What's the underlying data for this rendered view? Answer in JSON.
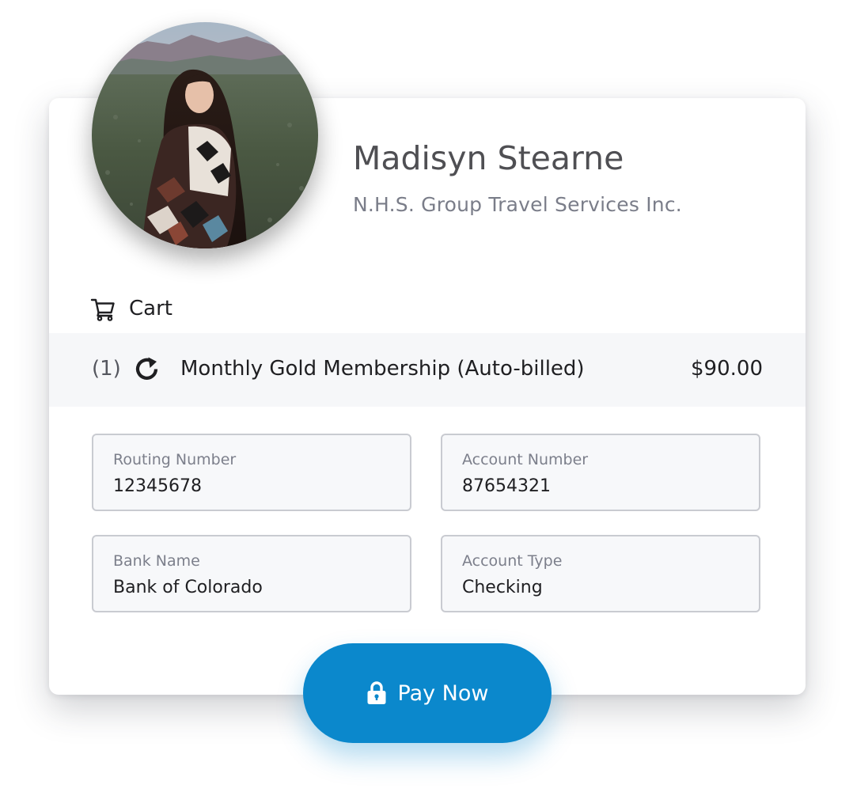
{
  "profile": {
    "name": "Madisyn Stearne",
    "company": "N.H.S. Group Travel Services Inc."
  },
  "cart": {
    "header_label": "Cart",
    "header_icon": "cart-icon",
    "items": [
      {
        "quantity": "(1)",
        "icon": "renew-icon",
        "name": "Monthly Gold Membership (Auto-billed)",
        "price": "$90.00"
      }
    ]
  },
  "form": {
    "routing_number": {
      "label": "Routing Number",
      "value": "12345678"
    },
    "account_number": {
      "label": "Account Number",
      "value": "87654321"
    },
    "bank_name": {
      "label": "Bank Name",
      "value": "Bank of Colorado"
    },
    "account_type": {
      "label": "Account Type",
      "value": "Checking"
    }
  },
  "pay_button": {
    "label": "Pay Now",
    "icon": "lock-icon",
    "color": "#0b88cc"
  },
  "colors": {
    "accent": "#0b88cc",
    "row_background": "#f6f7f9",
    "field_background": "#f7f8fa"
  }
}
